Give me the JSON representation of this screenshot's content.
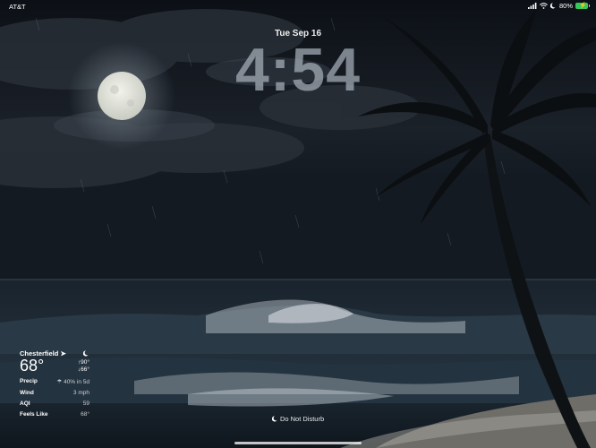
{
  "status_bar": {
    "carrier": "AT&T",
    "battery_percent": "80%",
    "icons": [
      "signal-icon",
      "wifi-icon",
      "moon-icon",
      "battery-charging-icon"
    ]
  },
  "lock_screen": {
    "date": "Tue Sep 16",
    "time": "4:54"
  },
  "weather_widget": {
    "location": "Chesterfield",
    "temperature": "68°",
    "high": "↑90°",
    "low": "↓66°",
    "rows": [
      {
        "label": "Precip",
        "value": "40% in 5d"
      },
      {
        "label": "Wind",
        "value": "3 mph"
      },
      {
        "label": "AQI",
        "value": "59"
      },
      {
        "label": "Feels Like",
        "value": "68°"
      }
    ]
  },
  "focus": {
    "label": "Do Not Disturb"
  },
  "colors": {
    "battery": "#35c759",
    "sky": "#0b0f14",
    "sea": "#1c2733"
  }
}
